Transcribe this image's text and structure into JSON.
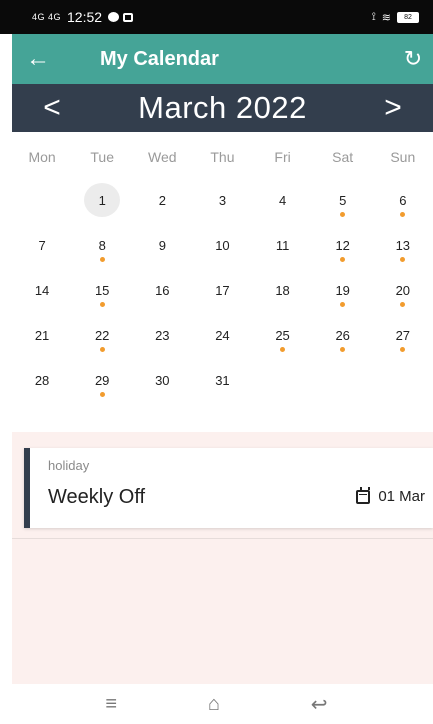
{
  "status_bar": {
    "network": "4G 4G",
    "time": "12:52",
    "battery": "82"
  },
  "app_bar": {
    "back_icon": "←",
    "title": "My Calendar",
    "refresh_icon": "↻"
  },
  "month_header": {
    "prev_icon": "<",
    "label": "March 2022",
    "next_icon": ">"
  },
  "weekdays": [
    "Mon",
    "Tue",
    "Wed",
    "Thu",
    "Fri",
    "Sat",
    "Sun"
  ],
  "calendar": {
    "first_weekday_offset": 1,
    "days_in_month": 31,
    "today": 1,
    "event_days": [
      5,
      6,
      8,
      12,
      13,
      15,
      19,
      20,
      22,
      25,
      26,
      27,
      29
    ],
    "dot_color": "#f29c2e"
  },
  "events": [
    {
      "type": "holiday",
      "name": "Weekly Off",
      "date": "01 Mar"
    }
  ],
  "nav_bar": {
    "menu_icon": "≡",
    "home_icon": "⌂",
    "back_icon": "↩"
  },
  "colors": {
    "app_bar": "#45a497",
    "month_bar": "#333e4d",
    "events_bg": "#fcf0ee"
  }
}
